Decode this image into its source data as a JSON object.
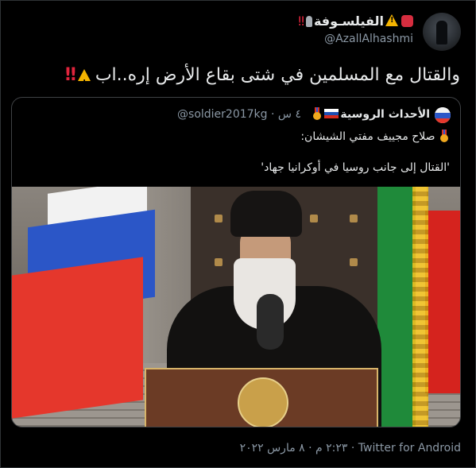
{
  "tweet": {
    "display_name": "الفيلسـوفة",
    "handle": "@AzallAlhashmi",
    "text": "والقتال مع المسلمين في شتى بقاع الأرض إره..اب",
    "source_line": "٢:٢٣ م · ٨ مارس ٢٠٢٢ · Twitter for Android"
  },
  "quoted_tweet": {
    "display_name": "الأحداث الروسية",
    "handle": "@soldier2017kg",
    "time": "٤ س",
    "separator": "·",
    "line1": "صلاح مجييف مفتي الشيشان:",
    "line2": "'القتال إلى جانب روسيا في أوكرانيا جهاد'"
  },
  "icons": {
    "avatar": "profile-avatar",
    "stop": "stop-sign-icon",
    "warning": "warning-icon",
    "pawn": "chess-pawn-icon",
    "exclamation": "double-exclamation-icon",
    "flag": "russia-flag-icon",
    "medal": "medal-icon"
  },
  "colors": {
    "background": "#000000",
    "text": "#e7e9ea",
    "secondary": "#8b98a5",
    "border": "#2f3336",
    "alert_red": "#e0243c",
    "warning_yellow": "#f5b400"
  }
}
